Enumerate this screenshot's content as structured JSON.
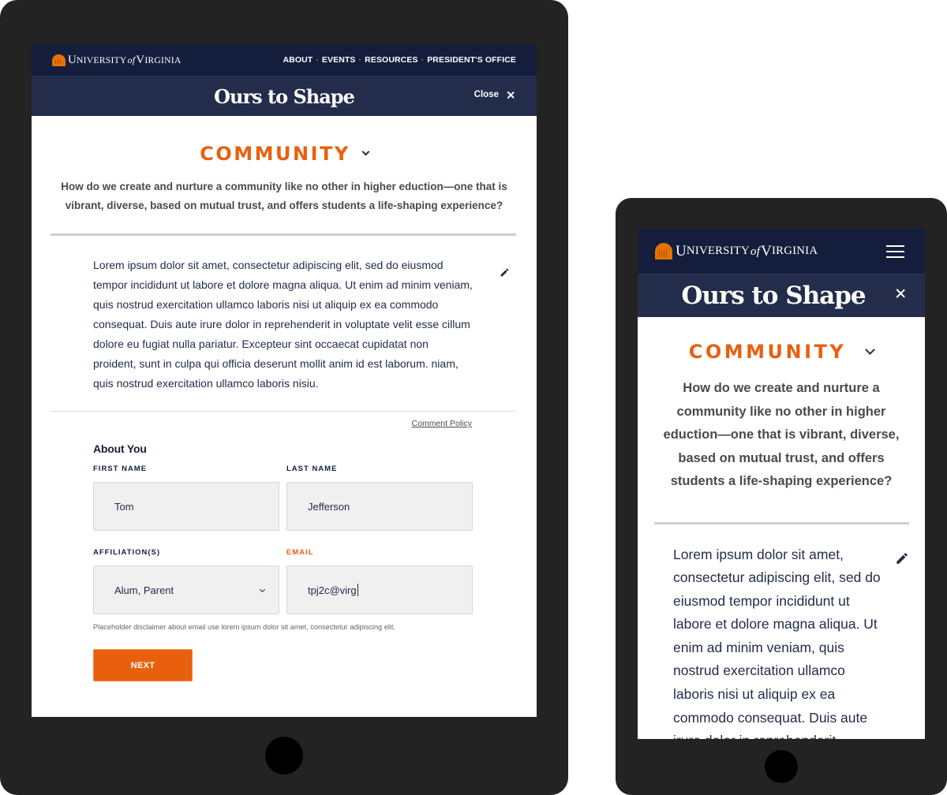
{
  "brand": {
    "logo_text": {
      "u": "U",
      "niversity": "NIVERSITY",
      "of": "of",
      "v": "V",
      "irginia": "IRGINIA"
    },
    "accent_color": "#e8600e",
    "navy_dark": "#141e3c",
    "navy": "#232d4b"
  },
  "tablet": {
    "nav": [
      "ABOUT",
      "EVENTS",
      "RESOURCES",
      "PRESIDENT'S OFFICE"
    ],
    "nav_separator": "·",
    "site_title": "Ours to Shape",
    "close_label": "Close",
    "topic": "COMMUNITY",
    "question": "How do we create and nurture a community like no other in higher eduction—one that is vibrant, diverse, based on mutual trust, and offers students a life-shaping experience?",
    "comment_text": "Lorem ipsum dolor sit amet, consectetur adipiscing elit, sed do eiusmod tempor incididunt ut labore et dolore magna aliqua. Ut enim ad minim veniam, quis nostrud exercitation ullamco laboris nisi ut aliquip ex ea commodo consequat. Duis aute irure dolor in reprehenderit in voluptate velit esse cillum dolore eu fugiat nulla pariatur. Excepteur sint occaecat cupidatat non proident, sunt in culpa qui officia deserunt mollit anim id est laborum. niam, quis nostrud exercitation ullamco laboris nisiu.",
    "comment_policy": "Comment Policy",
    "form": {
      "section_title": "About You",
      "first_name": {
        "label": "FIRST NAME",
        "value": "Tom"
      },
      "last_name": {
        "label": "LAST NAME",
        "value": "Jefferson"
      },
      "affiliation": {
        "label": "AFFILIATION(S)",
        "value": "Alum, Parent"
      },
      "email": {
        "label": "EMAIL",
        "value": "tpj2c@virg",
        "state": "error"
      },
      "disclaimer": "Placeholder disclaimer about email use lorem ipsum dolor sit amet, consectetur adipiscing elit.",
      "next_label": "NEXT"
    }
  },
  "phone": {
    "site_title": "Ours to Shape",
    "topic": "COMMUNITY",
    "question": "How do we create and nurture a community like no other in higher eduction—one that is vibrant, diverse, based on mutual trust, and offers students a life-shaping experience?",
    "comment_text": "Lorem ipsum dolor sit amet, consectetur adipiscing elit, sed do eiusmod tempor incididunt ut labore et dolore magna aliqua. Ut enim ad minim veniam, quis nostrud exercitation ullamco laboris nisi ut aliquip ex ea commodo consequat. Duis aute irure dolor in reprehenderit"
  }
}
